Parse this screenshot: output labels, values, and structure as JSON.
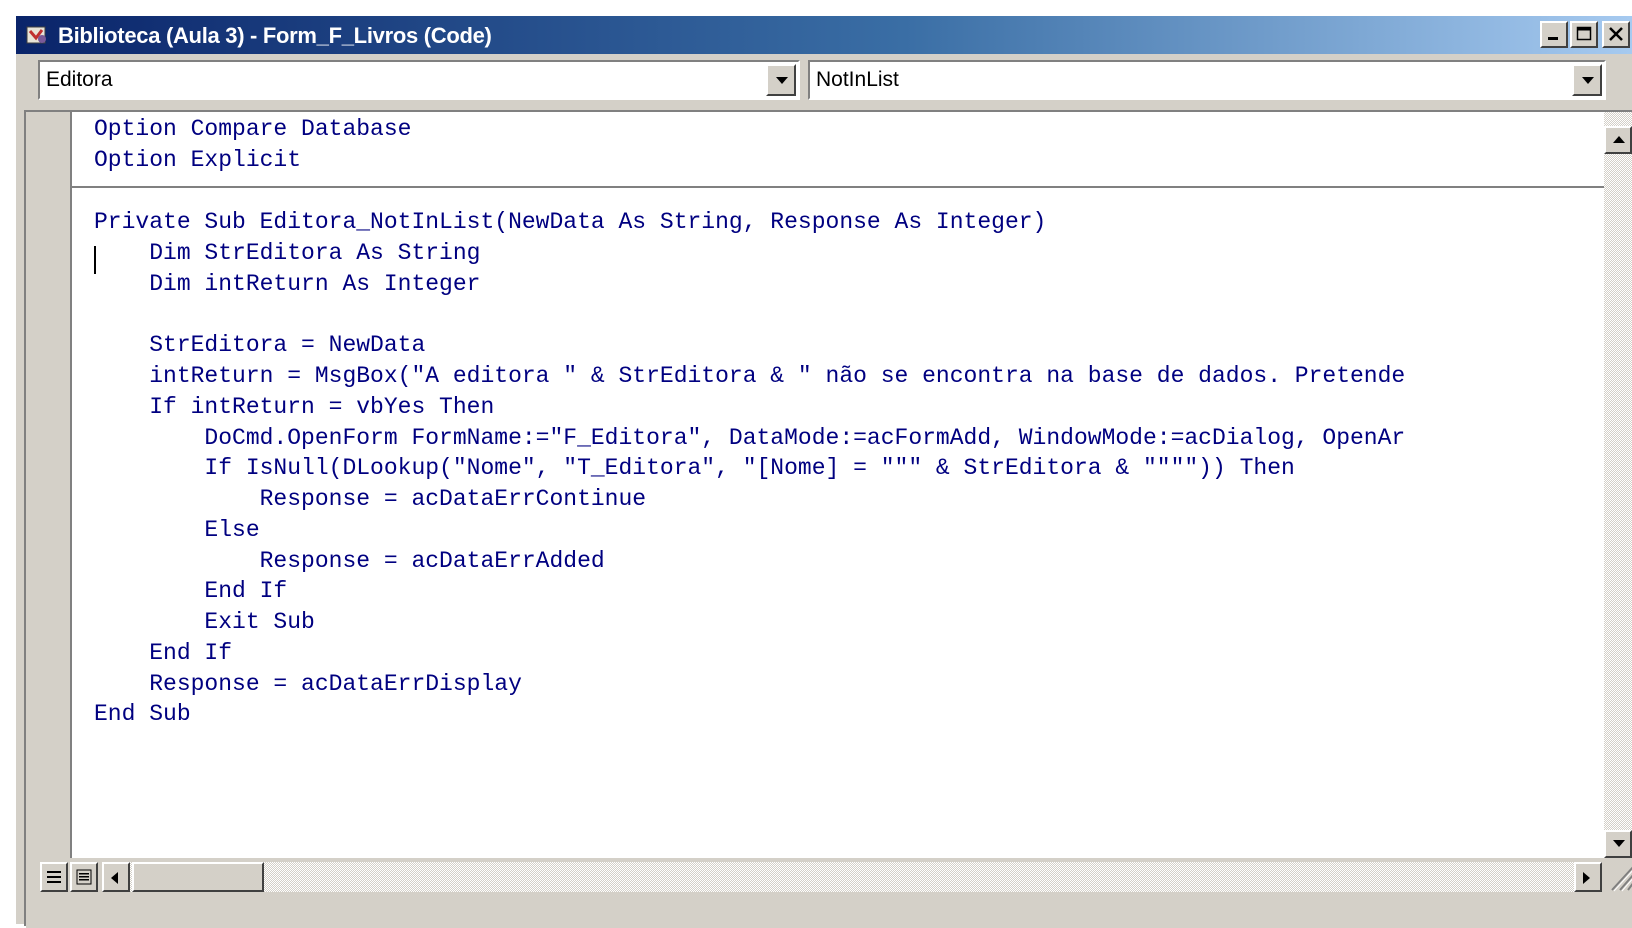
{
  "window": {
    "title": "Biblioteca (Aula 3) - Form_F_Livros (Code)",
    "buttons": [
      "minimize",
      "maximize",
      "close"
    ]
  },
  "object_combo": {
    "value": "Editora"
  },
  "procedure_combo": {
    "value": "NotInList"
  },
  "code": {
    "declarations": [
      "Option Compare Database",
      "Option Explicit"
    ],
    "lines": [
      "Private Sub Editora_NotInList(NewData As String, Response As Integer)",
      "    Dim StrEditora As String",
      "    Dim intReturn As Integer",
      "",
      "    StrEditora = NewData",
      "    intReturn = MsgBox(\"A editora \" & StrEditora & \" não se encontra na base de dados. Pretende",
      "    If intReturn = vbYes Then",
      "        DoCmd.OpenForm FormName:=\"F_Editora\", DataMode:=acFormAdd, WindowMode:=acDialog, OpenAr",
      "        If IsNull(DLookup(\"Nome\", \"T_Editora\", \"[Nome] = \"\"\" & StrEditora & \"\"\"\")) Then",
      "            Response = acDataErrContinue",
      "        Else",
      "            Response = acDataErrAdded",
      "        End If",
      "        Exit Sub",
      "    End If",
      "    Response = acDataErrDisplay",
      "End Sub"
    ]
  },
  "colors": {
    "code_text": "#000080",
    "title_bar_start": "#0a246a",
    "title_bar_end": "#a6caf0",
    "chrome": "#d4d0c8"
  },
  "icons": {
    "title": "vba-module-icon",
    "procedure_view": "procedure-view-icon",
    "full_module_view": "full-module-view-icon"
  }
}
